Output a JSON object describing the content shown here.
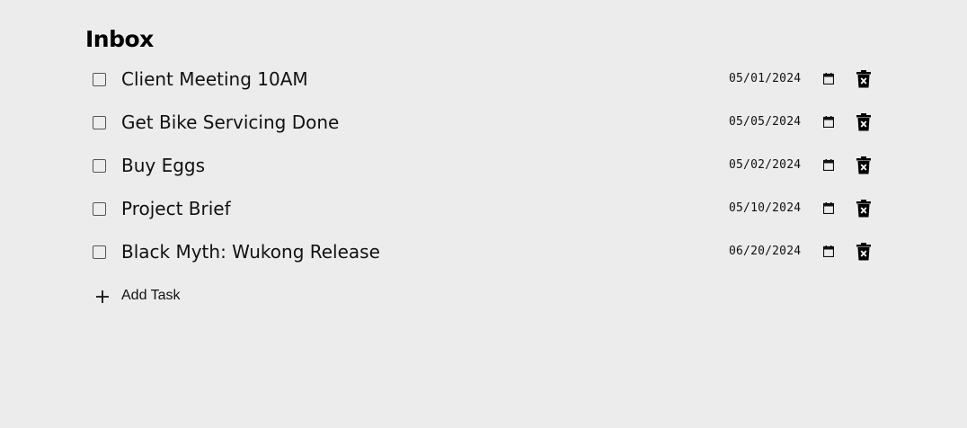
{
  "page": {
    "title": "Inbox"
  },
  "tasks": [
    {
      "label": "Client Meeting 10AM",
      "date": "05/01/2024",
      "checked": false
    },
    {
      "label": "Get Bike Servicing Done",
      "date": "05/05/2024",
      "checked": false
    },
    {
      "label": "Buy Eggs",
      "date": "05/02/2024",
      "checked": false
    },
    {
      "label": "Project Brief",
      "date": "05/10/2024",
      "checked": false
    },
    {
      "label": "Black Myth: Wukong Release",
      "date": "06/20/2024",
      "checked": false
    }
  ],
  "add_task": {
    "label": "Add Task",
    "icon": "plus-icon"
  },
  "icons": {
    "date_picker": "calendar-icon",
    "delete": "trash-icon"
  },
  "colors": {
    "background": "#ececec",
    "text": "#111111"
  }
}
